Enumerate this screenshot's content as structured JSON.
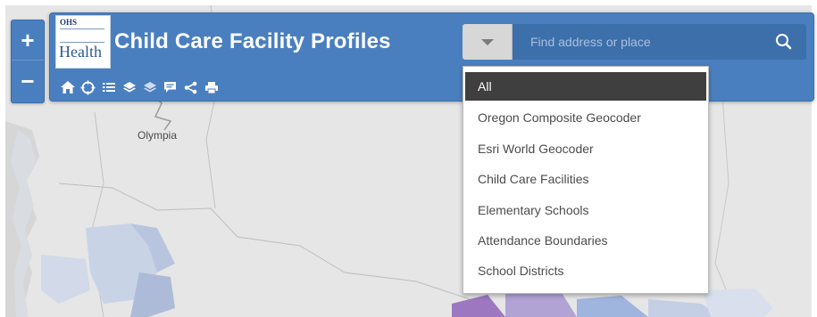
{
  "app": {
    "title": "Child Care Facility Profiles",
    "logo_top_text": "OHS",
    "logo_word": "Health"
  },
  "search": {
    "placeholder": "Find address or place",
    "value": ""
  },
  "zoom": {
    "in_label": "+",
    "out_label": "−"
  },
  "map": {
    "city_label": "Olympia"
  },
  "search_sources": {
    "selected": "All",
    "items": [
      {
        "label": "All"
      },
      {
        "label": "Oregon Composite Geocoder"
      },
      {
        "label": "Esri World Geocoder"
      },
      {
        "label": "Child Care Facilities"
      },
      {
        "label": "Elementary Schools"
      },
      {
        "label": "Attendance Boundaries"
      },
      {
        "label": "School Districts"
      }
    ]
  },
  "toolbar": {
    "tools": [
      "home-icon",
      "locate-icon",
      "list-icon",
      "layers-icon",
      "layers-alt-icon",
      "comment-icon",
      "share-icon",
      "print-icon"
    ]
  },
  "colors": {
    "header_blue": "#4a7fbf",
    "search_blue": "#3d6faa",
    "selected_item": "#3f3f3f"
  }
}
